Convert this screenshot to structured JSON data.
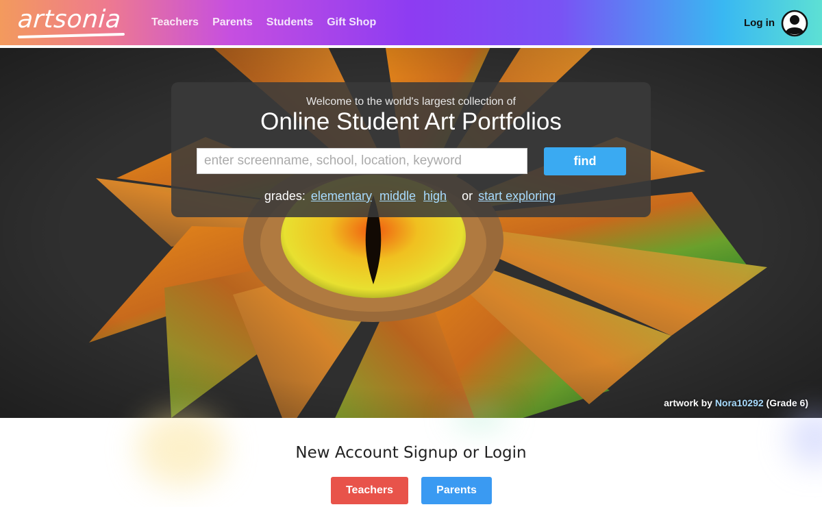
{
  "header": {
    "logo": "artsonia",
    "nav": [
      "Teachers",
      "Parents",
      "Students",
      "Gift Shop"
    ],
    "login_label": "Log in"
  },
  "search": {
    "welcome": "Welcome to the world's largest collection of",
    "headline": "Online Student Art Portfolios",
    "placeholder": "enter screenname, school, location, keyword",
    "find_label": "find",
    "grades_label": "grades:",
    "grades": [
      "elementary",
      "middle",
      "high"
    ],
    "or_label": "or",
    "explore_label": "start exploring"
  },
  "credit": {
    "prefix": "artwork by",
    "artist": "Nora10292",
    "grade": "(Grade 6)"
  },
  "signup": {
    "title": "New Account Signup or Login",
    "teachers_label": "Teachers",
    "parents_label": "Parents"
  },
  "colors": {
    "find_button": "#3aaaf2",
    "teachers_button": "#e8534a",
    "parents_button": "#3a9af2",
    "link": "#a8dcff"
  },
  "icons": {
    "user": "user-circle-icon"
  }
}
